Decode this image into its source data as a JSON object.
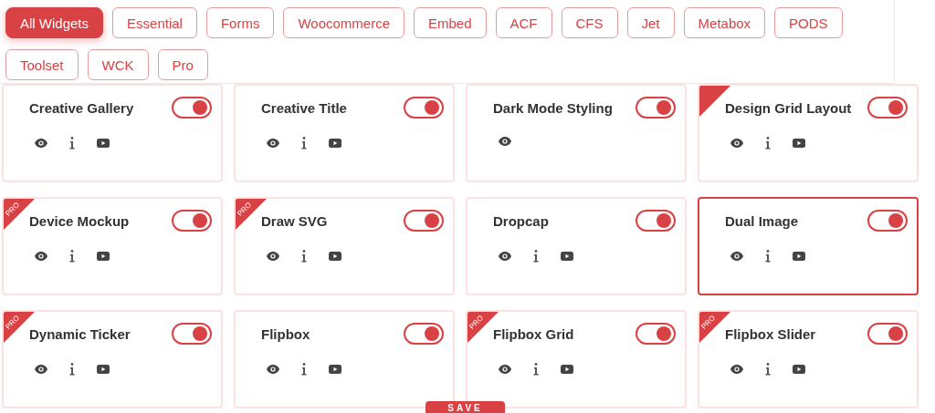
{
  "filters": [
    {
      "label": "All Widgets",
      "selected": true
    },
    {
      "label": "Essential",
      "selected": false
    },
    {
      "label": "Forms",
      "selected": false
    },
    {
      "label": "Woocommerce",
      "selected": false
    },
    {
      "label": "Embed",
      "selected": false
    },
    {
      "label": "ACF",
      "selected": false
    },
    {
      "label": "CFS",
      "selected": false
    },
    {
      "label": "Jet",
      "selected": false
    },
    {
      "label": "Metabox",
      "selected": false
    },
    {
      "label": "PODS",
      "selected": false
    },
    {
      "label": "Toolset",
      "selected": false
    },
    {
      "label": "WCK",
      "selected": false
    },
    {
      "label": "Pro",
      "selected": false
    }
  ],
  "widgets": [
    {
      "title": "Creative Gallery",
      "on": true,
      "selected": false,
      "demo": true,
      "docs": true,
      "video": true
    },
    {
      "title": "Creative Title",
      "on": true,
      "selected": false,
      "demo": true,
      "docs": true,
      "video": true
    },
    {
      "title": "Dark Mode Styling",
      "on": true,
      "selected": false,
      "demo": true,
      "docs": false,
      "video": false
    },
    {
      "title": "Design Grid Layout",
      "on": true,
      "selected": false,
      "ribbon": true,
      "demo": true,
      "docs": true,
      "video": true
    },
    {
      "title": "Device Mockup",
      "on": true,
      "selected": false,
      "ribbon": true,
      "ribbon_text": "PRO",
      "demo": true,
      "docs": true,
      "video": true
    },
    {
      "title": "Draw SVG",
      "on": true,
      "selected": false,
      "ribbon": true,
      "ribbon_text": "PRO",
      "demo": true,
      "docs": true,
      "video": true
    },
    {
      "title": "Dropcap",
      "on": true,
      "selected": false,
      "demo": true,
      "docs": true,
      "video": true
    },
    {
      "title": "Dual Image",
      "on": true,
      "selected": true,
      "demo": true,
      "docs": true,
      "video": true
    },
    {
      "title": "Dynamic Ticker",
      "on": true,
      "selected": false,
      "ribbon": true,
      "ribbon_text": "PRO",
      "demo": true,
      "docs": true,
      "video": true
    },
    {
      "title": "Flipbox",
      "on": true,
      "selected": false,
      "demo": true,
      "docs": true,
      "video": true
    },
    {
      "title": "Flipbox Grid",
      "on": true,
      "selected": false,
      "ribbon": true,
      "ribbon_text": "PRO",
      "demo": true,
      "docs": true,
      "video": true
    },
    {
      "title": "Flipbox Slider",
      "on": true,
      "selected": false,
      "ribbon": true,
      "ribbon_text": "PRO",
      "demo": true,
      "docs": true,
      "video": true
    }
  ],
  "save_button": "SAVE"
}
